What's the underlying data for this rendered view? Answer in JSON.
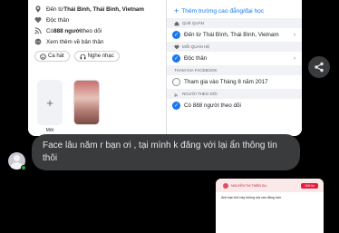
{
  "screenshot": {
    "left_panel": {
      "rows": [
        {
          "icon": "location-icon",
          "prefix": "Đến từ ",
          "bold": "Thái Bình, Thái Bình, Vietnam"
        },
        {
          "icon": "heart-icon",
          "prefix": "Độc thân",
          "bold": ""
        },
        {
          "icon": "rss-icon",
          "prefix": "Có ",
          "bold": "888 người",
          "suffix": " theo dõi"
        },
        {
          "icon": "more-icon",
          "prefix": "Xem thêm về bản thân",
          "bold": ""
        }
      ],
      "pills": [
        "Ca hát",
        "Nghe nhạc"
      ],
      "featured_add_label": "Mới"
    },
    "right_panel": {
      "add_school": "Thêm trường cao đẳng/đại học",
      "sections": [
        {
          "header": "QUÊ QUÁN",
          "option": "Đến từ Thái Bình, Thái Bình, Vietnam",
          "checked": true
        },
        {
          "header": "MỐI QUAN HỆ",
          "option": "Độc thân",
          "checked": true
        },
        {
          "header": "THAM GIA FACEBOOK",
          "option": "Tham gia vào Tháng 8 năm 2017",
          "checked": false
        },
        {
          "header": "NGƯỜI THEO DÕI",
          "option": "Có 888 người theo dõi",
          "checked": true
        }
      ]
    }
  },
  "message": {
    "text": "Face lâu năm r bạn ơi , tại mình k đăng với lại ẩn thông tin thôi"
  },
  "thumbnail": {
    "name": "NGUYỄN THỊ THIÊN DU",
    "chip": "Gửi tin",
    "line1": "Anh bạn thủ này không mà cần đăng hơn",
    "line2": ""
  },
  "colors": {
    "background": "#000000",
    "bubble": "#3a3b3c",
    "accent": "#1877f2",
    "online": "#31a24c"
  }
}
